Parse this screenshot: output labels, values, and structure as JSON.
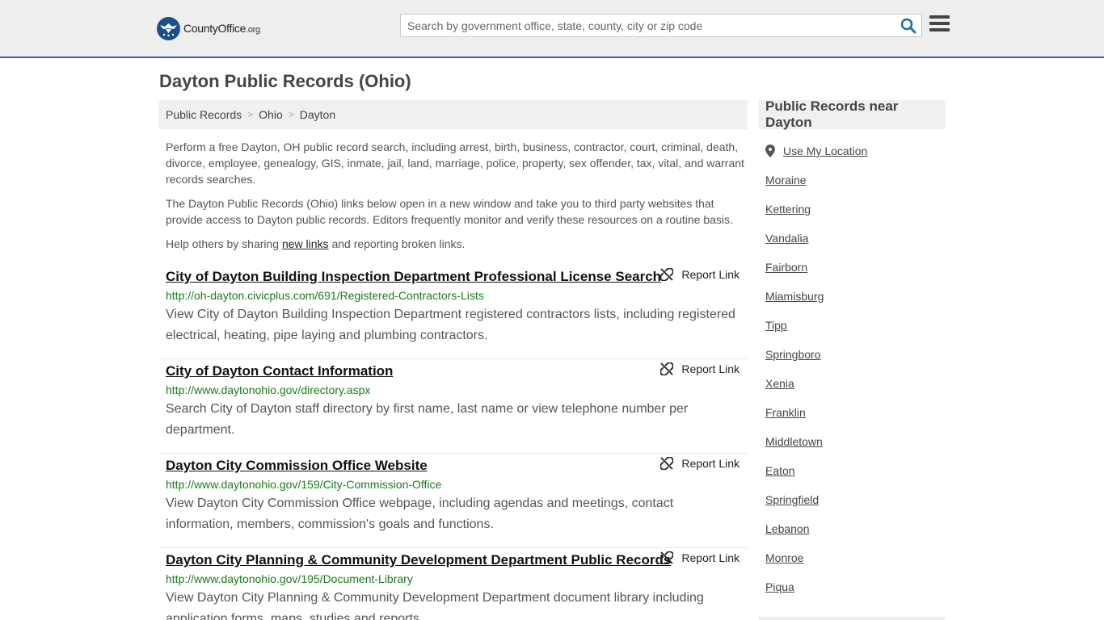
{
  "header": {
    "logo_main": "CountyOffice",
    "logo_suffix": ".org",
    "search_placeholder": "Search by government office, state, county, city or zip code",
    "brand_color": "#1b6ea8"
  },
  "page_title": "Dayton Public Records (Ohio)",
  "breadcrumb": [
    "Public Records",
    "Ohio",
    "Dayton"
  ],
  "intro": {
    "p1": "Perform a free Dayton, OH public record search, including arrest, birth, business, contractor, court, criminal, death, divorce, employee, genealogy, GIS, inmate, jail, land, marriage, police, property, sex offender, tax, vital, and warrant records searches.",
    "p2": "The Dayton Public Records (Ohio) links below open in a new window and take you to third party websites that provide access to Dayton public records. Editors frequently monitor and verify these resources on a routine basis.",
    "p3_before": "Help others by sharing ",
    "p3_link": "new links",
    "p3_after": " and reporting broken links."
  },
  "report_label": "Report Link",
  "results": [
    {
      "title": "City of Dayton Building Inspection Department Professional License Search",
      "url": "http://oh-dayton.civicplus.com/691/Registered-Contractors-Lists",
      "desc": "View City of Dayton Building Inspection Department registered contractors lists, including registered electrical, heating, pipe laying and plumbing contractors."
    },
    {
      "title": "City of Dayton Contact Information",
      "url": "http://www.daytonohio.gov/directory.aspx",
      "desc": "Search City of Dayton staff directory by first name, last name or view telephone number per department."
    },
    {
      "title": "Dayton City Commission Office Website",
      "url": "http://www.daytonohio.gov/159/City-Commission-Office",
      "desc": "View Dayton City Commission Office webpage, including agendas and meetings, contact information, members, commission's goals and functions."
    },
    {
      "title": "Dayton City Planning & Community Development Department Public Records",
      "url": "http://www.daytonohio.gov/195/Document-Library",
      "desc": "View Dayton City Planning & Community Development Department document library including application forms, maps, studies and reports."
    }
  ],
  "sidebar": {
    "heading": "Public Records near Dayton",
    "use_location": "Use My Location",
    "cities": [
      "Moraine",
      "Kettering",
      "Vandalia",
      "Fairborn",
      "Miamisburg",
      "Tipp",
      "Springboro",
      "Xenia",
      "Franklin",
      "Middletown",
      "Eaton",
      "Springfield",
      "Lebanon",
      "Monroe",
      "Piqua"
    ]
  }
}
